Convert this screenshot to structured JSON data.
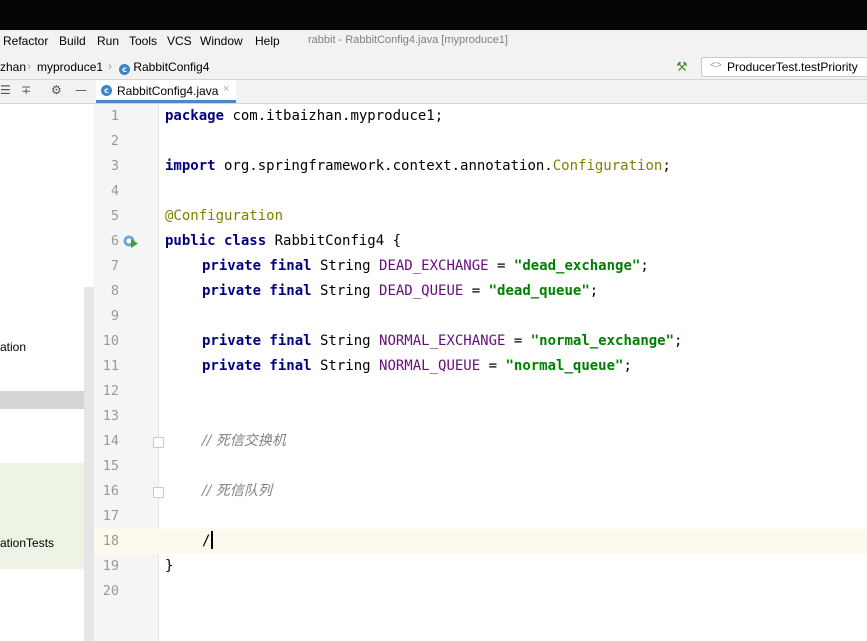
{
  "menu": {
    "items": [
      "Refactor",
      "Build",
      "Run",
      "Tools",
      "VCS",
      "Window",
      "Help"
    ],
    "window_title": "rabbit - RabbitConfig4.java [myproduce1]"
  },
  "nav": {
    "crumbs": [
      "zhan",
      "myproduce1",
      "RabbitConfig4"
    ],
    "class_icon_letter": "c",
    "run_config": "ProducerTest.testPriority"
  },
  "tabs": [
    {
      "label": "RabbitConfig4.java",
      "close": "×"
    }
  ],
  "project": {
    "toolbar_icons": [
      "☰",
      "∓",
      "⚙",
      "—"
    ],
    "items": [
      "ation",
      "ationTests"
    ]
  },
  "editor": {
    "lines": [
      "1",
      "2",
      "3",
      "4",
      "5",
      "6",
      "7",
      "8",
      "9",
      "10",
      "11",
      "12",
      "13",
      "14",
      "15",
      "16",
      "17",
      "18",
      "19",
      "20"
    ],
    "code": {
      "l1_kw": "package",
      "l1_rest": " com.itbaizhan.myproduce1;",
      "l3_kw": "import",
      "l3_pkg": " org.springframework.context.annotation.",
      "l3_cls": "Configuration",
      "l3_end": ";",
      "l5_ann": "@Configuration",
      "l6_kw": "public class",
      "l6_rest": " RabbitConfig4 {",
      "mods": "private final",
      "type": " String ",
      "f1": "DEAD_EXCHANGE",
      "v1": "\"dead_exchange\"",
      "f2": "DEAD_QUEUE",
      "v2": "\"dead_queue\"",
      "f3": "NORMAL_EXCHANGE",
      "v3": "\"normal_exchange\"",
      "f4": "NORMAL_QUEUE",
      "v4": "\"normal_queue\"",
      "eq": " = ",
      "semi": ";",
      "c14": "// 死信交换机",
      "c16": "// 死信队列",
      "l18": "/",
      "l19": "}"
    }
  },
  "colors": {
    "keyword": "#000080",
    "string": "#008000",
    "field": "#660e7a",
    "annotation": "#808000",
    "comment": "#808080",
    "tab_accent": "#4a88c7"
  }
}
